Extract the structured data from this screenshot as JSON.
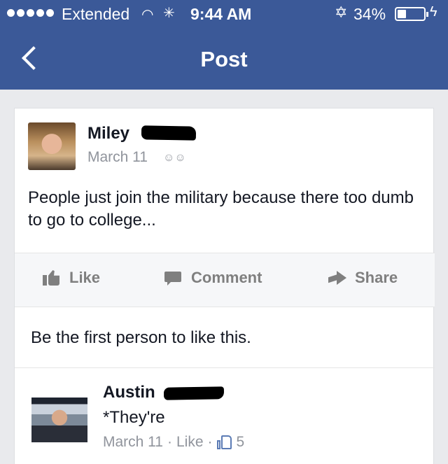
{
  "status_bar": {
    "carrier": "Extended",
    "time": "9:44 AM",
    "battery_percent": "34%",
    "battery_level": 0.34,
    "icons": [
      "signal-dots-icon",
      "wifi-icon",
      "activity-spinner-icon",
      "bluetooth-icon",
      "battery-icon",
      "charging-bolt-icon"
    ]
  },
  "nav": {
    "title": "Post",
    "back_icon": "chevron-left-icon"
  },
  "post": {
    "author_first_name": "Miley",
    "date": "March 11",
    "audience_icon": "friends-icon",
    "text": "People just join the military because there too dumb to go to college...",
    "actions": {
      "like": "Like",
      "comment": "Comment",
      "share": "Share"
    },
    "likes_summary": "Be the first person to like this."
  },
  "comment": {
    "author_first_name": "Austin",
    "text": "*They're",
    "date": "March 11",
    "separator": "·",
    "like_label": "Like",
    "like_count": "5"
  },
  "colors": {
    "header_blue": "#3b5998",
    "background": "#e9eaed",
    "meta_gray": "#90949c"
  }
}
